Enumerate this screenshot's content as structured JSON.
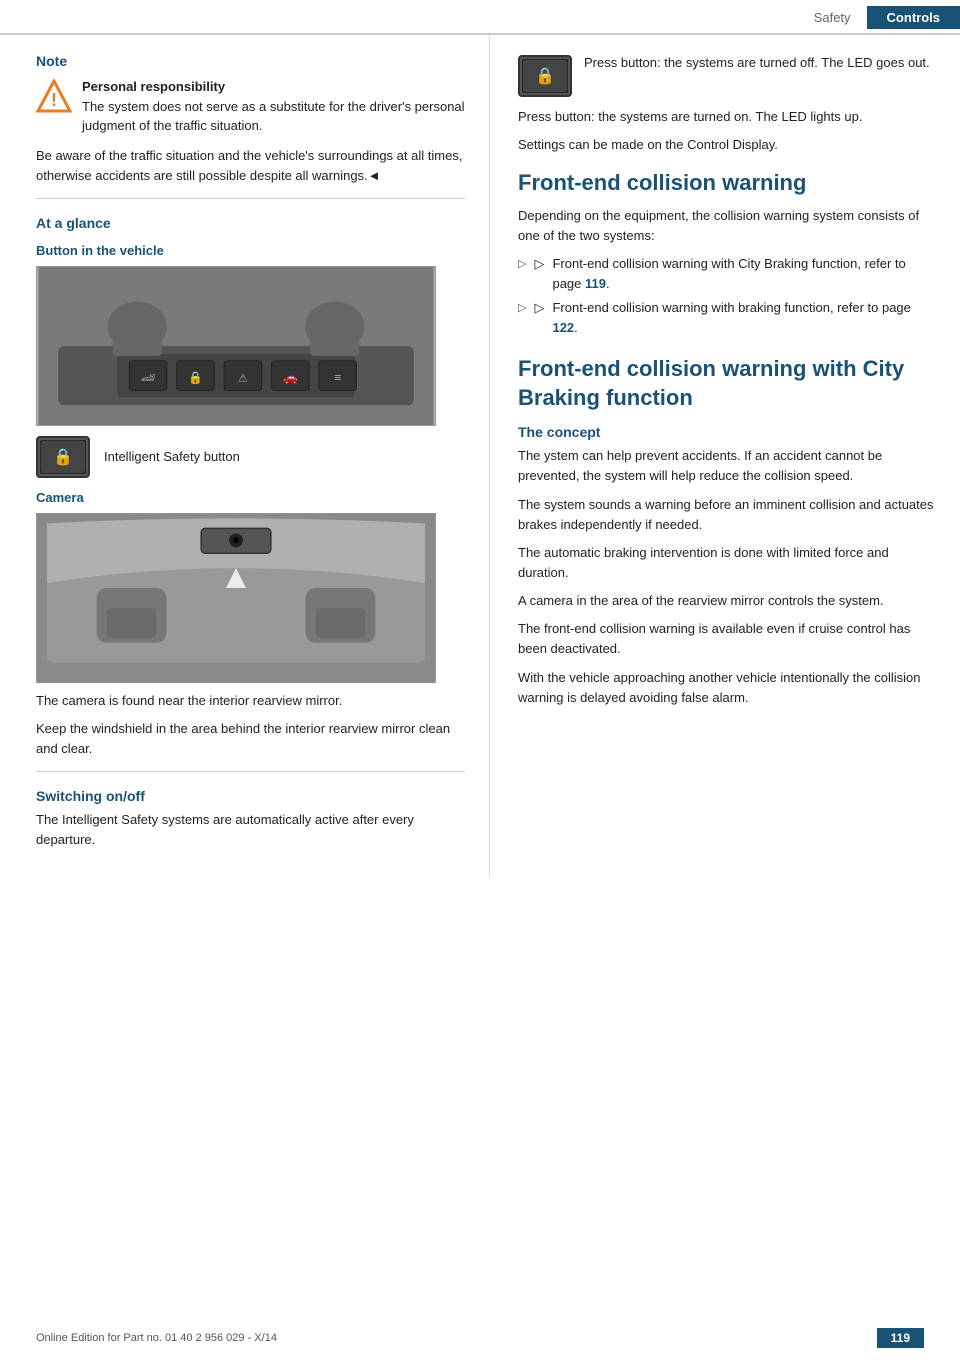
{
  "header": {
    "safety_label": "Safety",
    "controls_label": "Controls"
  },
  "left": {
    "note_title": "Note",
    "warning_bold": "Personal responsibility",
    "warning_text1": "The system does not serve as a substitute for the driver's personal judgment of the traffic situation.",
    "warning_text2": "Be aware of the traffic situation and the vehicle's surroundings at all times, otherwise accidents are still possible despite all warnings.◄",
    "at_glance": "At a glance",
    "button_in_vehicle": "Button in the vehicle",
    "isb_label": "Intelligent Safety button",
    "camera_heading": "Camera",
    "camera_text1": "The camera is found near the interior rearview mirror.",
    "camera_text2": "Keep the windshield in the area behind the interior rearview mirror clean and clear.",
    "switching_heading": "Switching on/off",
    "switching_text": "The Intelligent Safety systems are automatically active after every departure."
  },
  "right": {
    "press_button_text1": "Press button: the systems are turned off. The LED goes out.",
    "press_button_text2": "Press button: the systems are turned on. The LED lights up.",
    "settings_text": "Settings can be made on the Control Display.",
    "front_end_heading": "Front-end collision warning",
    "front_end_intro": "Depending on the equipment, the collision warning system consists of one of the two systems:",
    "bullet1": "Front-end collision warning with City Braking function, refer to page ",
    "bullet1_page": "119",
    "bullet2": "Front-end collision warning with braking function, refer to page ",
    "bullet2_page": "122",
    "front_end_city_heading": "Front-end collision warning with City Braking function",
    "concept_heading": "The concept",
    "concept_p1": "The ystem can help prevent accidents. If an accident cannot be prevented, the system will help reduce the collision speed.",
    "concept_p2": "The system sounds a warning before an imminent collision and actuates brakes independently if needed.",
    "concept_p3": "The automatic braking intervention is done with limited force and duration.",
    "concept_p4": "A camera in the area of the rearview mirror controls the system.",
    "concept_p5": "The front-end collision warning is available even if cruise control has been deactivated.",
    "concept_p6": "With the vehicle approaching another vehicle intentionally the collision warning is delayed avoiding false alarm."
  },
  "footer": {
    "copyright": "Online Edition for Part no. 01 40 2 956 029 - X/14",
    "page": "119"
  }
}
